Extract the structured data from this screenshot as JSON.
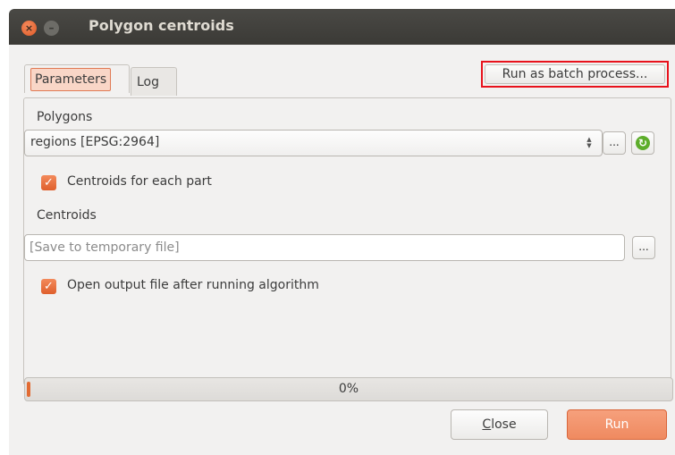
{
  "window": {
    "title": "Polygon centroids",
    "close_glyph": "×",
    "minimize_glyph": "–"
  },
  "tabs": [
    {
      "label": "Parameters",
      "active": true
    },
    {
      "label": "Log",
      "active": false
    }
  ],
  "batch_button": {
    "label": "Run as batch process..."
  },
  "polygons": {
    "label": "Polygons",
    "selected": "regions [EPSG:2964]",
    "browse_label": "..."
  },
  "centroids_each_part": {
    "label": "Centroids for each part",
    "checked": true
  },
  "centroids": {
    "label": "Centroids",
    "placeholder": "[Save to temporary file]",
    "browse_label": "..."
  },
  "open_output": {
    "label": "Open output file after running algorithm",
    "checked": true
  },
  "progress": {
    "value": 0,
    "text": "0%"
  },
  "buttons": {
    "close_mnemonic": "C",
    "close_rest": "lose",
    "run": "Run"
  },
  "colors": {
    "accent": "#ef8a60",
    "highlight_border": "#e8121c",
    "checkbox": "#df5f2c",
    "titlebar": "#3b3a36"
  },
  "icons": {
    "close": "close-icon",
    "minimize": "minimize-icon",
    "spinner": "spinner-arrows-icon",
    "sync": "refresh-icon",
    "check": "checkmark-icon"
  }
}
